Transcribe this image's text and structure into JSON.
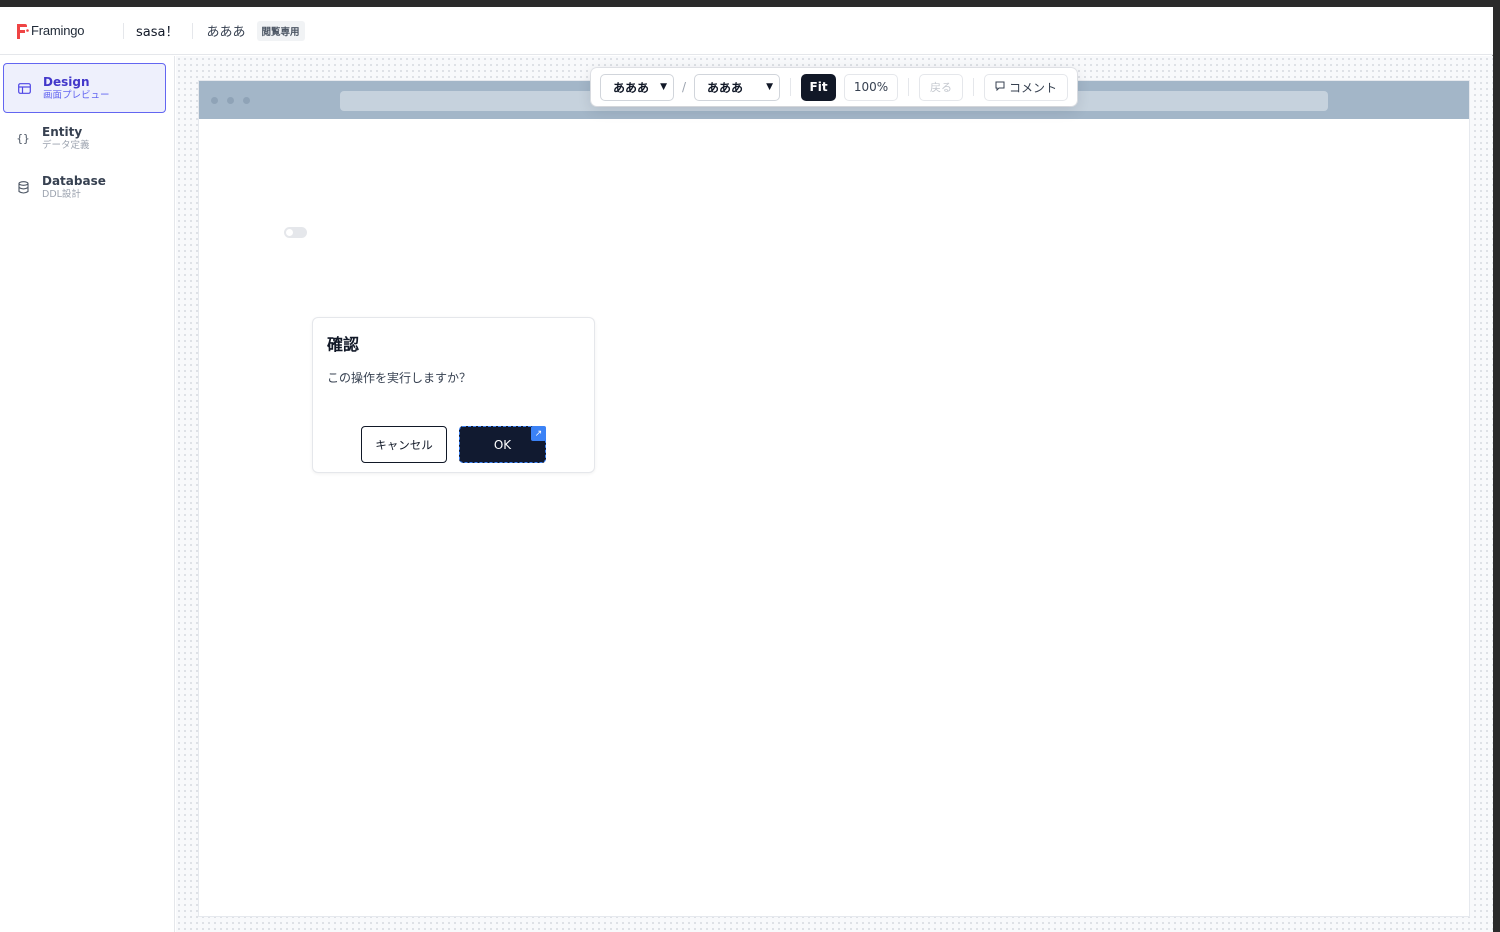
{
  "app": {
    "logo_text": "Framingo",
    "brand_color": "#ef4444"
  },
  "header": {
    "project_name": "sasa！",
    "screen_name": "あああ",
    "readonly_badge": "閲覧専用"
  },
  "sidebar": {
    "items": [
      {
        "title": "Design",
        "subtitle": "画面プレビュー",
        "icon": "layout-icon",
        "active": true
      },
      {
        "title": "Entity",
        "subtitle": "データ定義",
        "icon": "braces-icon",
        "active": false
      },
      {
        "title": "Database",
        "subtitle": "DDL設計",
        "icon": "database-icon",
        "active": false
      }
    ]
  },
  "toolbar": {
    "select_1": "あああ",
    "separator": "/",
    "select_2": "あああ",
    "fit_label": "Fit",
    "zoom_label": "100%",
    "back_label": "戻る",
    "comment_label": "コメント"
  },
  "preview": {
    "toggle_on": false,
    "dialog": {
      "title": "確認",
      "message": "この操作を実行しますか？",
      "cancel_label": "キャンセル",
      "ok_label": "OK"
    }
  },
  "colors": {
    "accent": "#4f46e5",
    "dark_button": "#111827",
    "link_badge": "#3b82f6"
  }
}
